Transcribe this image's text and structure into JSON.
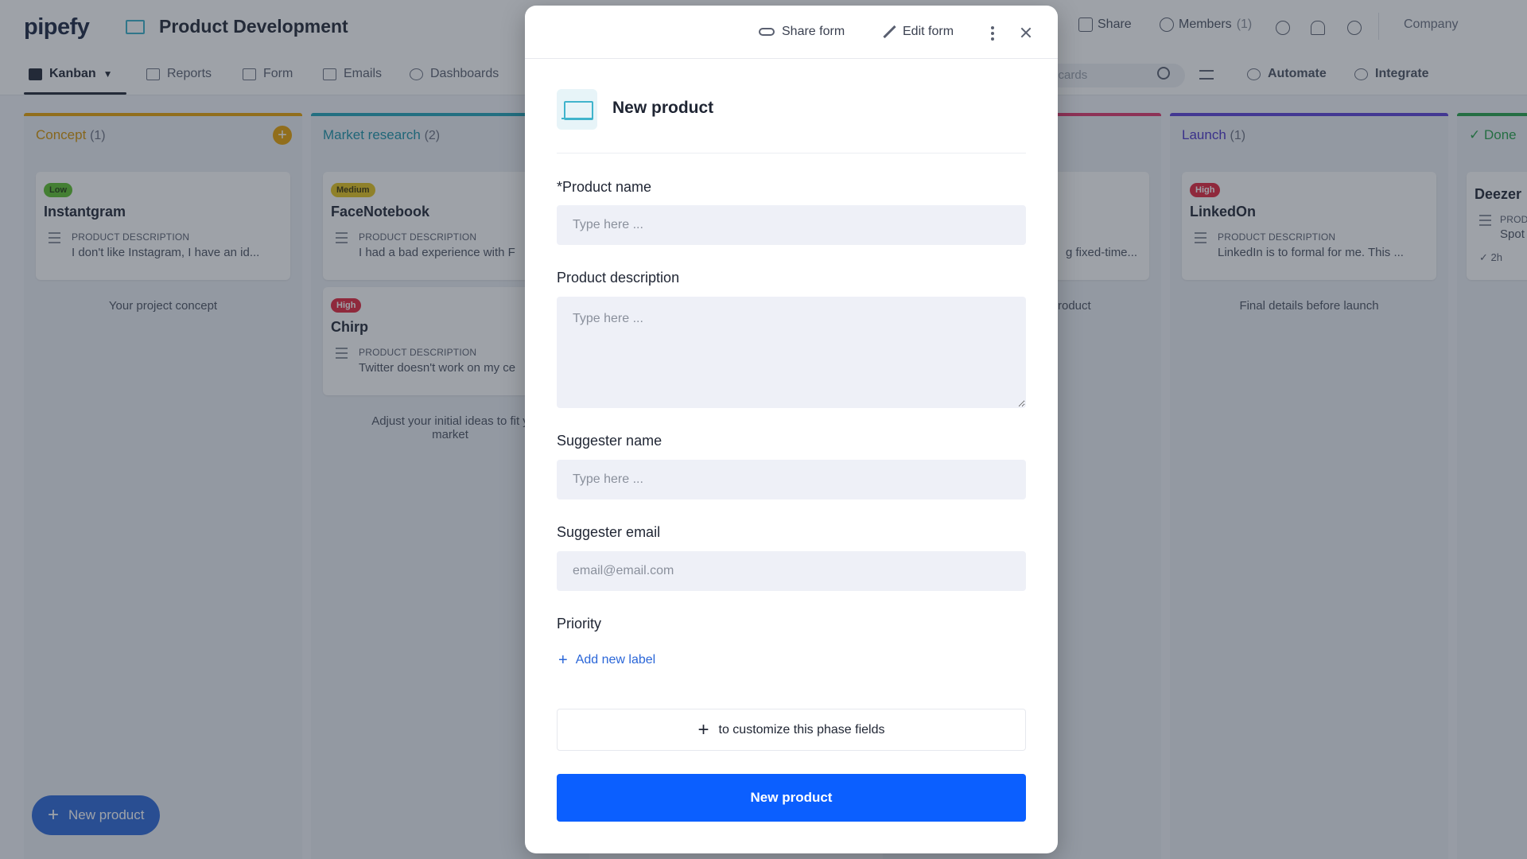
{
  "header": {
    "logo": "pipefy",
    "pipe_title": "Product Development",
    "actions": {
      "share": "Share",
      "members": "Members",
      "members_count": "(1)",
      "company": "Company"
    }
  },
  "tabs": {
    "kanban": "Kanban",
    "reports": "Reports",
    "form": "Form",
    "emails": "Emails",
    "dashboards": "Dashboards",
    "search_placeholder": "n cards",
    "automate": "Automate",
    "integrate": "Integrate"
  },
  "phases": [
    {
      "title": "Concept",
      "count": "(1)",
      "color": "#e8a000",
      "description": "Your project concept",
      "cards": [
        {
          "badge": "Low",
          "title": "Instantgram",
          "field": "PRODUCT DESCRIPTION",
          "value": "I don't like Instagram, I have an id..."
        }
      ]
    },
    {
      "title": "Market research",
      "count": "(2)",
      "color": "#1fa3b8",
      "description_line1": "Adjust your initial ideas to fit y",
      "description_line2": "market",
      "cards": [
        {
          "badge": "Medium",
          "title": "FaceNotebook",
          "field": "PRODUCT DESCRIPTION",
          "value": "I had a bad experience with F"
        },
        {
          "badge": "High",
          "title": "Chirp",
          "field": "PRODUCT DESCRIPTION",
          "value": "Twitter doesn't work on my ce"
        }
      ]
    },
    {
      "title": "",
      "count": "",
      "color": "#e0336a",
      "description": "roduct",
      "cards": [
        {
          "value": "g fixed-time..."
        }
      ]
    },
    {
      "title": "Launch",
      "count": "(1)",
      "color": "#5a3fd8",
      "description": "Final details before launch",
      "cards": [
        {
          "badge": "High",
          "title": "LinkedOn",
          "field": "PRODUCT DESCRIPTION",
          "value": "LinkedIn is to formal for me. This ..."
        }
      ]
    },
    {
      "title": "Done",
      "count": "",
      "color": "#24a148",
      "cards": [
        {
          "title": "Deezer",
          "field": "PROD",
          "value": "Spot",
          "time": "2h"
        }
      ]
    }
  ],
  "fab_label": "New product",
  "modal": {
    "share_form": "Share form",
    "edit_form": "Edit form",
    "title": "New product",
    "fields": {
      "product_name": {
        "label": "*Product name",
        "placeholder": "Type here ...",
        "value": ""
      },
      "product_description": {
        "label": "Product description",
        "placeholder": "Type here ...",
        "value": ""
      },
      "suggester_name": {
        "label": "Suggester name",
        "placeholder": "Type here ...",
        "value": ""
      },
      "suggester_email": {
        "label": "Suggester email",
        "placeholder": "email@email.com",
        "value": ""
      },
      "priority": {
        "label": "Priority",
        "add_label": "Add new label"
      }
    },
    "customize_text": "to customize this phase fields",
    "submit_label": "New product"
  },
  "colors": {
    "primary": "#0b5fff",
    "badge_low": "#5cbf2a",
    "badge_medium": "#e3c41a",
    "badge_high": "#e3243b"
  }
}
